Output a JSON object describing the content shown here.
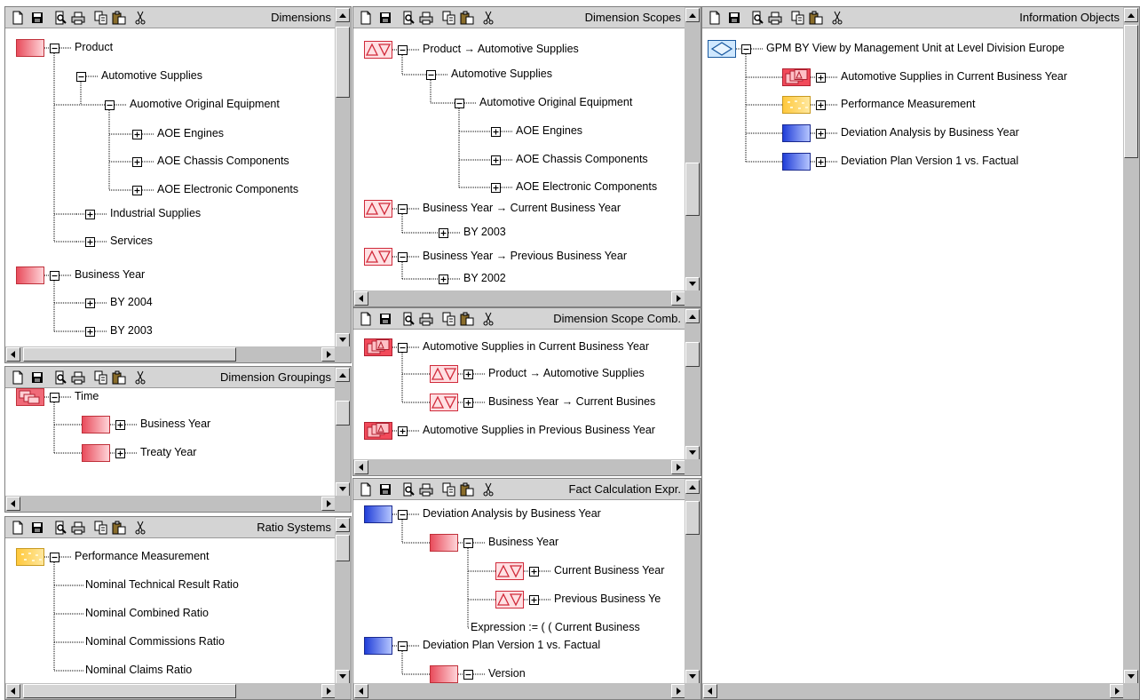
{
  "toolbar": {
    "icons": [
      "new-file-icon",
      "save-icon",
      "print-preview-icon",
      "print-icon",
      "copy-icon",
      "paste-icon",
      "cut-icon"
    ]
  },
  "panels": [
    {
      "id": "dimensions",
      "title": "Dimensions",
      "nodes": [
        {
          "label": "Product",
          "icon": "dimension-icon",
          "expander": "minus"
        },
        {
          "label": "Automotive Supplies",
          "icon": "",
          "expander": "minus"
        },
        {
          "label": "Auomotive Original Equipment",
          "icon": "",
          "expander": "minus"
        },
        {
          "label": "AOE Engines",
          "icon": "",
          "expander": "plus"
        },
        {
          "label": "AOE Chassis Components",
          "icon": "",
          "expander": "plus"
        },
        {
          "label": "AOE Electronic Components",
          "icon": "",
          "expander": "plus"
        },
        {
          "label": "Industrial Supplies",
          "icon": "",
          "expander": "plus"
        },
        {
          "label": "Services",
          "icon": "",
          "expander": "plus"
        },
        {
          "label": "Business Year",
          "icon": "dimension-icon",
          "expander": "minus"
        },
        {
          "label": "BY 2004",
          "icon": "",
          "expander": "plus"
        },
        {
          "label": "BY 2003",
          "icon": "",
          "expander": "plus"
        }
      ]
    },
    {
      "id": "groupings",
      "title": "Dimension Groupings",
      "nodes": [
        {
          "label": "Time",
          "icon": "grouping-icon",
          "expander": "minus"
        },
        {
          "label": "Business Year",
          "icon": "dimension-icon",
          "expander": "plus"
        },
        {
          "label": "Treaty Year",
          "icon": "dimension-icon",
          "expander": "plus"
        }
      ]
    },
    {
      "id": "ratio",
      "title": "Ratio Systems",
      "nodes": [
        {
          "label": "Performance Measurement",
          "icon": "ratio-system-icon",
          "expander": "minus"
        },
        {
          "label": "Nominal Technical Result Ratio",
          "icon": "",
          "expander": ""
        },
        {
          "label": "Nominal Combined Ratio",
          "icon": "",
          "expander": ""
        },
        {
          "label": "Nominal Commissions Ratio",
          "icon": "",
          "expander": ""
        },
        {
          "label": "Nominal Claims Ratio",
          "icon": "",
          "expander": ""
        }
      ]
    },
    {
      "id": "scopes",
      "title": "Dimension Scopes",
      "nodes": [
        {
          "label": "Product → Automotive Supplies",
          "icon": "scope-icon",
          "expander": "minus"
        },
        {
          "label": "Automotive Supplies",
          "icon": "",
          "expander": "minus"
        },
        {
          "label": "Automotive Original Equipment",
          "icon": "",
          "expander": "minus"
        },
        {
          "label": "AOE Engines",
          "icon": "",
          "expander": "plus"
        },
        {
          "label": "AOE Chassis Components",
          "icon": "",
          "expander": "plus"
        },
        {
          "label": "AOE Electronic Components",
          "icon": "",
          "expander": "plus"
        },
        {
          "label": "Business Year → Current Business Year",
          "icon": "scope-icon",
          "expander": "minus"
        },
        {
          "label": "BY 2003",
          "icon": "",
          "expander": "plus"
        },
        {
          "label": "Business Year → Previous Business Year",
          "icon": "scope-icon",
          "expander": "minus"
        },
        {
          "label": "BY 2002",
          "icon": "",
          "expander": "plus"
        }
      ]
    },
    {
      "id": "combos",
      "title": "Dimension Scope Comb.",
      "nodes": [
        {
          "label": "Automotive Supplies in Current Business Year",
          "icon": "scope-combination-icon",
          "expander": "minus"
        },
        {
          "label": "Product → Automotive Supplies",
          "icon": "scope-icon",
          "expander": "plus"
        },
        {
          "label": "Business Year → Current Busines",
          "icon": "scope-icon",
          "expander": "plus"
        },
        {
          "label": "Automotive Supplies in Previous Business Year",
          "icon": "scope-combination-icon",
          "expander": "plus"
        }
      ]
    },
    {
      "id": "facts",
      "title": "Fact Calculation Expr.",
      "nodes": [
        {
          "label": "Deviation Analysis by Business Year",
          "icon": "fact-calculation-icon",
          "expander": "minus"
        },
        {
          "label": "Business Year",
          "icon": "dimension-icon",
          "expander": "minus"
        },
        {
          "label": "Current Business Year",
          "icon": "scope-icon",
          "expander": "plus"
        },
        {
          "label": "Previous  Business Ye",
          "icon": "scope-icon",
          "expander": "plus"
        },
        {
          "label": "Expression := ( ( Current  Business",
          "icon": "",
          "expander": ""
        },
        {
          "label": "Deviation Plan Version 1 vs. Factual",
          "icon": "fact-calculation-icon",
          "expander": "minus"
        },
        {
          "label": "Version",
          "icon": "dimension-icon",
          "expander": "minus"
        }
      ]
    },
    {
      "id": "info",
      "title": "Information Objects",
      "nodes": [
        {
          "label": "GPM BY View by Management Unit at Level Division Europe",
          "icon": "view-icon",
          "expander": "minus"
        },
        {
          "label": "Automotive Supplies in Current Business Year",
          "icon": "scope-combination-icon",
          "expander": "plus"
        },
        {
          "label": "Performance Measurement",
          "icon": "ratio-system-icon",
          "expander": "plus"
        },
        {
          "label": "Deviation Analysis by Business Year",
          "icon": "fact-calculation-icon",
          "expander": "plus"
        },
        {
          "label": "Deviation Plan Version 1 vs. Factual",
          "icon": "fact-calculation-icon",
          "expander": "plus"
        }
      ]
    }
  ]
}
